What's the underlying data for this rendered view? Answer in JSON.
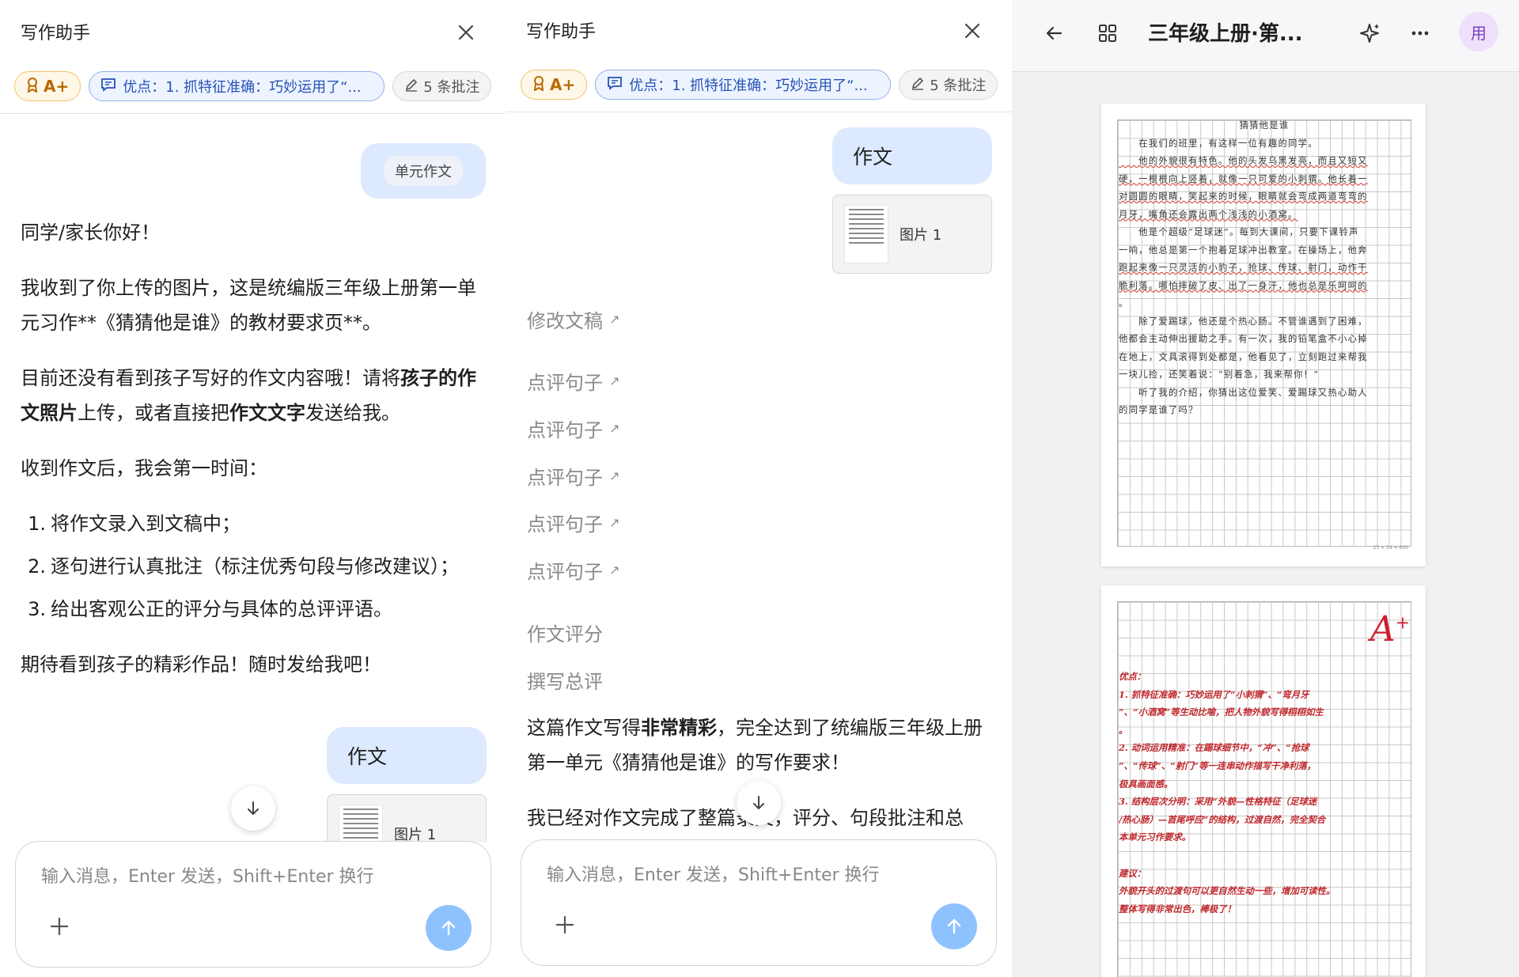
{
  "panel1": {
    "title": "写作助手",
    "chips": {
      "grade": "A+",
      "merit": "优点：1. 抓特征准确：巧妙运用了“...",
      "notes": "5 条批注"
    },
    "unit_tag": "单元作文",
    "greeting": "同学/家长你好！",
    "p1": "我收到了你上传的图片，这是统编版三年级上册第一单元习作**《猜猜他是谁》的教材要求页**。",
    "p2_a": "目前还没有看到孩子写好的作文内容哦！请将",
    "p2_b": "孩子的作文照片",
    "p2_c": "上传，或者直接把",
    "p2_d": "作文文字",
    "p2_e": "发送给我。",
    "p3": "收到作文后，我会第一时间：",
    "list": [
      {
        "n": "1.",
        "t": "将作文录入到文稿中；"
      },
      {
        "n": "2.",
        "t": "逐句进行认真批注（标注优秀句段与修改建议）；"
      },
      {
        "n": "3.",
        "t": "给出客观公正的评分与具体的总评评语。"
      }
    ],
    "p4": "期待看到孩子的精彩作品！随时发给我吧！",
    "essay_bubble": "作文",
    "image_label": "图片 1",
    "input_placeholder": "输入消息，Enter 发送，Shift+Enter 换行"
  },
  "panel2": {
    "title": "写作助手",
    "chips": {
      "grade": "A+",
      "merit": "优点：1. 抓特征准确：巧妙运用了“...",
      "notes": "5 条批注"
    },
    "essay_bubble": "作文",
    "image_label": "图片 1",
    "links": [
      "修改文稿",
      "点评句子",
      "点评句子",
      "点评句子",
      "点评句子",
      "点评句子"
    ],
    "sections": [
      "作文评分",
      "撰写总评"
    ],
    "r1_a": "这篇作文写得",
    "r1_b": "非常精彩",
    "r1_c": "，完全达到了统编版三年级上册第一单元《猜猜他是谁》的写作要求！",
    "r2": "我已经对作文完成了整篇录文，评分、句段批注和总",
    "input_placeholder": "输入消息，Enter 发送，Shift+Enter 换行"
  },
  "panel3": {
    "doc_title": "三年级上册·第...",
    "avatar": "用",
    "essay_title": "猜猜他是谁",
    "essay_lines": [
      "　　在我们的班里，有这样一位有趣的同学。",
      "　　他的外貌很有特色。他的头发乌黑发亮，而且又短又",
      "硬，一根根向上竖着，就像一只可爱的小刺猬。他长着一",
      "对圆圆的眼睛，笑起来的时候，眼睛就会弯成两道弯弯的",
      "月牙，嘴角还会露出两个浅浅的小酒窝。",
      "　　他是个超级“足球迷”。每到大课间，只要下课铃声",
      "一响，他总是第一个抱着足球冲出教室。在操场上，他奔",
      "跑起来像一只灵活的小豹子，抢球、传球、射门，动作干",
      "脆利落。哪怕摔破了皮、出了一身汗，他也总是乐呵呵的",
      "。",
      "　　除了爱踢球，他还是个热心肠。不管谁遇到了困难，",
      "他都会主动伸出援助之手。有一次，我的铅笔盒不小心掉",
      "在地上，文具滚得到处都是，他看见了，立刻跑过来帮我",
      "一块儿捡，还笑着说：“别着急，我来帮你！”",
      "　　听了我的介绍，你猜出这位爱笑、爱踢球又热心助人",
      "的同学是谁了吗？"
    ],
    "grid_note": "25 × 24 = 600",
    "grade_mark": "A",
    "grade_sup": "+",
    "comments": [
      "优点：",
      "1. 抓特征准确：巧妙运用了“小刺猬”、“弯月牙",
      "”、“小酒窝”等生动比喻，把人物外貌写得栩栩如生",
      "。",
      "2. 动词运用精准：在踢球细节中，“冲”、“抢球",
      "”、“传球”、“射门”等一连串动作描写干净利落，",
      "极具画面感。",
      "3. 结构层次分明：采用“外貌—性格特征（足球迷",
      "/热心肠）—首尾呼应”的结构，过渡自然，完全契合",
      "本单元习作要求。",
      "",
      "建议：",
      "外貌开头的过渡句可以更自然生动一些，增加可读性。",
      "整体写得非常出色，棒极了！"
    ]
  }
}
